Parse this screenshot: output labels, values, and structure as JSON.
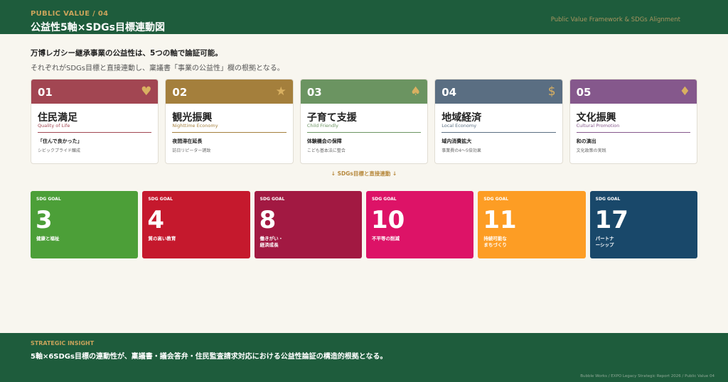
{
  "header": {
    "kicker": "PUBLIC VALUE / 04",
    "title": "公益性5軸×SDGs目標連動図",
    "right": "Public Value Framework & SDGs Alignment"
  },
  "lead": {
    "line1": "万博レガシー継承事業の公益性は、5つの軸で論証可能。",
    "line2": "それぞれがSDGs目標と直接連動し、稟議書「事業の公益性」欄の根拠となる。"
  },
  "axes": [
    {
      "num": "01",
      "icon": "heart-icon",
      "glyph": "♥",
      "name": "住民満足",
      "en": "Quality of Life",
      "desc": "「住んで良かった」",
      "sub": "シビックプライド醸成",
      "color": "#a24652",
      "icon_color": "#d9b061",
      "line_color": "#a24652"
    },
    {
      "num": "02",
      "icon": "star-icon",
      "glyph": "★",
      "name": "観光振興",
      "en": "Nighttime Economy",
      "desc": "夜間滞在延長",
      "sub": "訪日リピーター誘致",
      "color": "#a47f3c",
      "icon_color": "#d9b061",
      "line_color": "#a47f3c"
    },
    {
      "num": "03",
      "icon": "spade-icon",
      "glyph": "♠",
      "name": "子育て支援",
      "en": "Child Friendly",
      "desc": "体験機会の保障",
      "sub": "こども基本法に整合",
      "color": "#6b9461",
      "icon_color": "#d9b061",
      "line_color": "#6b9461"
    },
    {
      "num": "04",
      "icon": "dollar-icon",
      "glyph": "$",
      "name": "地域経済",
      "en": "Local Economy",
      "desc": "域内消費拡大",
      "sub": "事業費の4〜5倍効果",
      "color": "#5a6e82",
      "icon_color": "#d9b061",
      "line_color": "#5a6e82"
    },
    {
      "num": "05",
      "icon": "diamond-icon",
      "glyph": "♦",
      "name": "文化振興",
      "en": "Cultural Promotion",
      "desc": "和の演出",
      "sub": "文化政策の実践",
      "color": "#85588c",
      "icon_color": "#d9b061",
      "line_color": "#85588c"
    }
  ],
  "connector": "↓  SDGs目標と直接連動  ↓",
  "sdgs": [
    {
      "label": "SDG GOAL",
      "num": "3",
      "name": "健康と福祉",
      "color": "#4c9f38"
    },
    {
      "label": "SDG GOAL",
      "num": "4",
      "name": "質の高い教育",
      "color": "#c5192d"
    },
    {
      "label": "SDG GOAL",
      "num": "8",
      "name": "働きがい・\n経済成長",
      "color": "#a21942"
    },
    {
      "label": "SDG GOAL",
      "num": "10",
      "name": "不平等の削減",
      "color": "#dd1367"
    },
    {
      "label": "SDG GOAL",
      "num": "11",
      "name": "持続可能な\nまちづくり",
      "color": "#fd9d24"
    },
    {
      "label": "SDG GOAL",
      "num": "17",
      "name": "パートナ\nーシップ",
      "color": "#19486a"
    }
  ],
  "footer": {
    "kicker": "STRATEGIC INSIGHT",
    "text": "5軸×6SDGs目標の連動性が、稟議書・議会答弁・住民監査請求対応における公益性論証の構造的根拠となる。",
    "credit": "Bubble Works  /  EXPO Legacy Strategic Report 2026  /  Public Value 04"
  }
}
